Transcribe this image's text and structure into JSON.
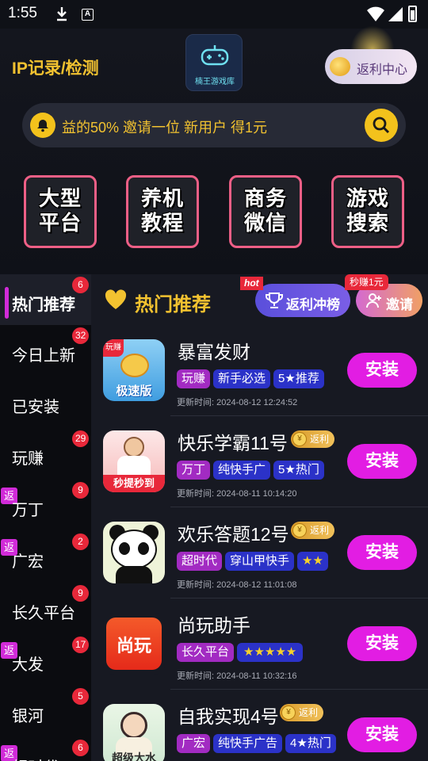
{
  "status_bar": {
    "time": "1:55"
  },
  "header": {
    "brand_left": "IP记录/检测",
    "logo_text": "楠王游戏库",
    "rebate_center": "返利中心",
    "notice": "益的50% 邀请一位 新用户 得1元",
    "tiles": [
      {
        "line1": "大型",
        "line2": "平台"
      },
      {
        "line1": "养机",
        "line2": "教程"
      },
      {
        "line1": "商务",
        "line2": "微信"
      },
      {
        "line1": "游戏",
        "line2": "搜索"
      }
    ]
  },
  "sidebar": {
    "items": [
      {
        "label": "热门推荐",
        "badge": "6",
        "active": true,
        "return_tag": ""
      },
      {
        "label": "今日上新",
        "badge": "32",
        "return_tag": ""
      },
      {
        "label": "已安装",
        "badge": "",
        "return_tag": ""
      },
      {
        "label": "玩赚",
        "badge": "29",
        "return_tag": ""
      },
      {
        "label": "万丁",
        "badge": "9",
        "return_tag": "返"
      },
      {
        "label": "广宏",
        "badge": "2",
        "return_tag": "返"
      },
      {
        "label": "长久平台",
        "badge": "9",
        "return_tag": ""
      },
      {
        "label": "大发",
        "badge": "17",
        "return_tag": "返"
      },
      {
        "label": "银河",
        "badge": "5",
        "return_tag": ""
      },
      {
        "label": "超时代",
        "badge": "6",
        "return_tag": "返"
      }
    ]
  },
  "main": {
    "title": "热门推荐",
    "rank_button": "返利冲榜",
    "hot_tag": "hot",
    "invite_button": "邀请",
    "earn_tag": "秒赚1元",
    "install_label": "安装",
    "fanli_label": "返利",
    "fanli_coin": "¥",
    "update_prefix": "更新时间: ",
    "apps": [
      {
        "name": "暴富发财",
        "fanli": false,
        "tags": [
          "玩赚",
          "新手必选",
          "5★推荐"
        ],
        "update_time": "2024-08-12 12:24:52",
        "icon_text": "极速版",
        "corner_text": "玩赚"
      },
      {
        "name": "快乐学霸11号",
        "fanli": true,
        "tags": [
          "万丁",
          "纯快手广",
          "5★热门"
        ],
        "update_time": "2024-08-11 10:14:20",
        "icon_text": "秒提秒到"
      },
      {
        "name": "欢乐答题12号",
        "fanli": true,
        "tags": [
          "超时代",
          "穿山甲快手",
          "★★"
        ],
        "update_time": "2024-08-12 11:01:08"
      },
      {
        "name": "尚玩助手",
        "fanli": false,
        "tags": [
          "长久平台",
          "★★★★★"
        ],
        "update_time": "2024-08-11 10:32:16",
        "icon_text": "尚玩"
      },
      {
        "name": "自我实现4号",
        "fanli": true,
        "tags": [
          "广宏",
          "纯快手广告",
          "4★热门"
        ],
        "update_time": "",
        "icon_text": "超级大水"
      }
    ]
  },
  "colors": {
    "accent_yellow": "#f2c230",
    "install_magenta": "#e21de3",
    "tag_pink": "#a22bc2",
    "tag_blue": "#2b32c8",
    "badge_red": "#e8283a"
  }
}
